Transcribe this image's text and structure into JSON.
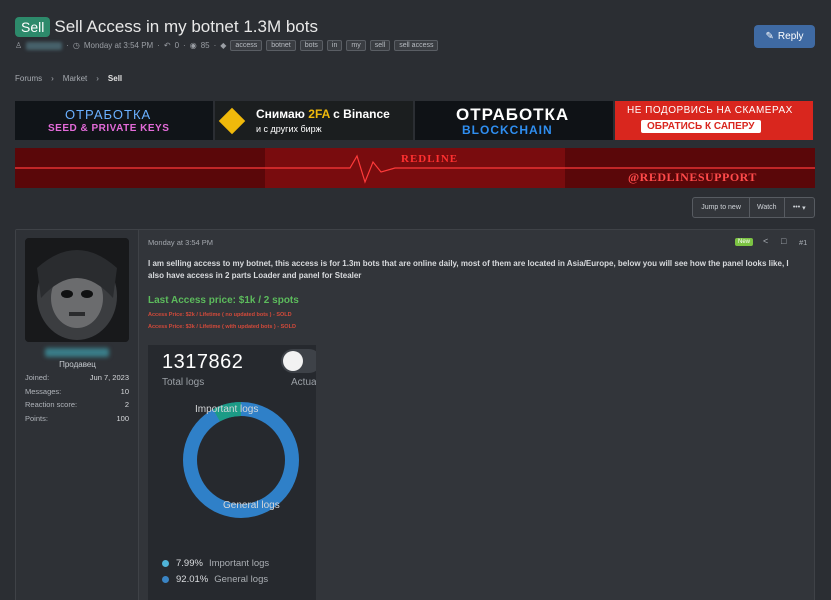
{
  "thread": {
    "prefix": "Sell",
    "title": "Sell Access in my botnet 1.3M bots",
    "date": "Monday at 3:54 PM",
    "replies": "0",
    "views": "85",
    "tags": [
      "access",
      "botnet",
      "bots",
      "in",
      "my",
      "sell",
      "sell access"
    ]
  },
  "reply_button": "Reply",
  "breadcrumbs": [
    "Forums",
    "Market",
    "Sell"
  ],
  "banners": {
    "b1_line1": "ОТРАБОТКА",
    "b1_line2": "SEED & PRIVATE KEYS",
    "b2_line1_a": "Снимаю ",
    "b2_line1_b": "2FA",
    "b2_line1_c": " с Binance",
    "b2_line2": "и с других бирж",
    "b3_line1": "ОТРАБОТКА",
    "b3_line2": "BLOCKCHAIN",
    "b4_line1": "НЕ ПОДОРВИСЬ НА СКАМЕРАХ",
    "b4_line2": "ОБРАТИСЬ К САПЕРУ",
    "redline_title": "REDLINE",
    "redline_handle": "@REDLINESUPPORT"
  },
  "thread_actions": [
    "Jump to new",
    "Watch",
    "•••"
  ],
  "post": {
    "user_role": "Продавец",
    "stats": [
      {
        "label": "Joined:",
        "value": "Jun 7, 2023"
      },
      {
        "label": "Messages:",
        "value": "10"
      },
      {
        "label": "Reaction score:",
        "value": "2"
      },
      {
        "label": "Points:",
        "value": "100"
      }
    ],
    "date": "Monday at 3:54 PM",
    "new_badge": "New",
    "number": "#1",
    "body": "I am selling access to my botnet, this access is for 1.3m bots that are online daily, most of them are located in Asia/Europe, below you will see how the panel looks like, I also have access in 2 parts Loader and panel for Stealer",
    "price": "Last Access price: $1k / 2 spots",
    "sold1": "Access Price: $2k / Lifetime ( no updated bots ) - SOLD",
    "sold2": "Access Price: $3k / Lifetime ( with updated bots ) - SOLD"
  },
  "panel": {
    "total": "1317862",
    "total_label": "Total logs",
    "actual_label": "Actua",
    "label_important": "Important logs",
    "label_general": "General logs",
    "legend": [
      {
        "pct": "7.99%",
        "name": "Important logs",
        "color": "#4fb3d8"
      },
      {
        "pct": "92.01%",
        "name": "General logs",
        "color": "#3a84c4"
      }
    ],
    "share_important": 7.99,
    "share_general": 92.01
  },
  "colors": {
    "accent": "#3f6aa3",
    "prefix": "#2d8a6b",
    "price_green": "#5cbb5c",
    "sold_red": "#d34a3a",
    "donut_main": "#2f80c8",
    "donut_important": "#1c9b86"
  }
}
